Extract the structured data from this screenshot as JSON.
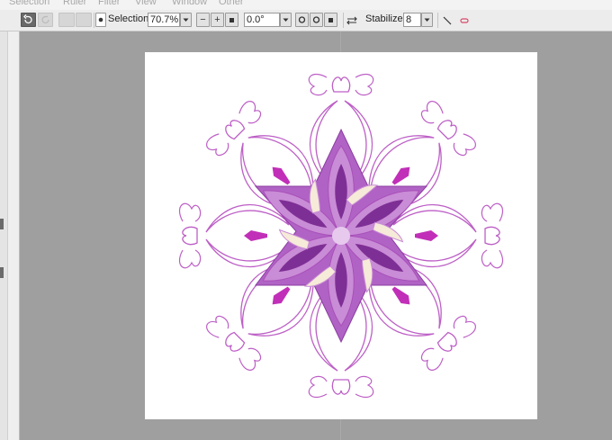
{
  "menu": [
    "Selection",
    "Ruler",
    "Filter",
    "View",
    "Window",
    "Other"
  ],
  "toolbar": {
    "selection_label": "Selection",
    "zoom_value": "70.7%",
    "minus_label": "−",
    "plus_label": "+",
    "rotation_value": "0.0°",
    "stabilizer_label": "Stabilizer",
    "stabilizer_value": "8"
  },
  "icons": [
    "undo-icon",
    "redo-icon",
    "selection-toggle-icon",
    "dropdown-arrow-icon",
    "zoom-reset-icon",
    "rotate-left-icon",
    "rotate-right-icon",
    "rotate-reset-icon",
    "flip-horizontal-icon",
    "line-tool-icon",
    "eraser-icon"
  ],
  "colors": {
    "dark_purple": "#7e2f95",
    "mid_purple": "#a94fba",
    "light_purple": "#c98cd6",
    "outline_purple": "#bd5fc6",
    "cream": "#f6ead9",
    "magenta": "#c12fb8"
  }
}
